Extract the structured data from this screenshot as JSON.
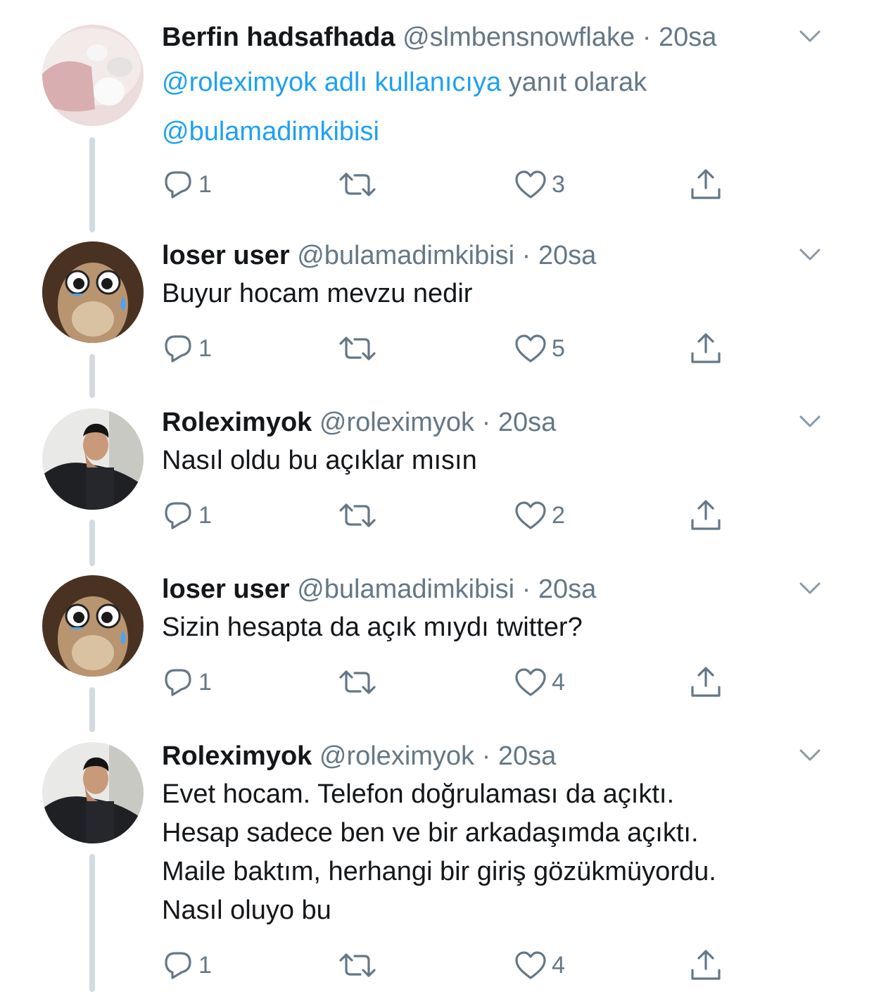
{
  "tweets": [
    {
      "name": "Berfin hadsafhada",
      "handle": "@slmbensnowflake",
      "time": "20sa",
      "reply_to_user": "@roleximyok adlı kullanıcıya",
      "reply_to_suffix": " yanıt olarak",
      "mention": "@bulamadimkibisi",
      "replies": "1",
      "likes": "3",
      "avatar": "cat-paw-photo"
    },
    {
      "name": "loser user",
      "handle": "@bulamadimkibisi",
      "time": "20sa",
      "text": "Buyur hocam mevzu nedir",
      "replies": "1",
      "likes": "5",
      "avatar": "alpaca-crying-emoji-photo"
    },
    {
      "name": "Roleximyok",
      "handle": "@roleximyok",
      "time": "20sa",
      "text": "Nasıl oldu bu açıklar mısın",
      "replies": "1",
      "likes": "2",
      "avatar": "man-portrait-photo"
    },
    {
      "name": "loser user",
      "handle": "@bulamadimkibisi",
      "time": "20sa",
      "text": "Sizin hesapta da açık mıydı twitter?",
      "replies": "1",
      "likes": "4",
      "avatar": "alpaca-crying-emoji-photo"
    },
    {
      "name": "Roleximyok",
      "handle": "@roleximyok",
      "time": "20sa",
      "lines": [
        "Evet hocam. Telefon doğrulaması da açıktı.",
        "Hesap sadece ben ve bir arkadaşımda açıktı.",
        "Maile baktım, herhangi bir giriş gözükmüyordu.",
        "Nasıl oluyo bu"
      ],
      "replies": "1",
      "likes": "4",
      "avatar": "man-portrait-photo"
    }
  ],
  "separator": " · ",
  "colors": {
    "link": "#1da1f2",
    "secondary": "#657786",
    "thread_line": "#d3dae1",
    "text": "#14171a"
  },
  "icons": [
    "reply-icon",
    "retweet-icon",
    "like-icon",
    "share-icon",
    "chevron-down-icon"
  ]
}
